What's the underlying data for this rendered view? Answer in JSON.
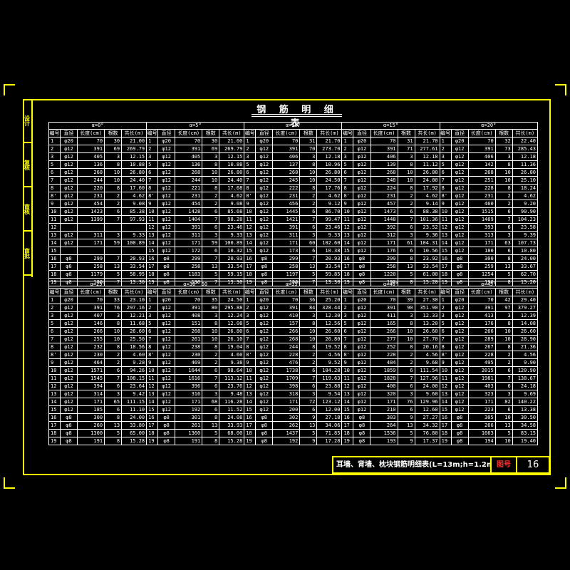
{
  "side_labels": [
    "设计",
    "复核",
    "审核",
    "审批"
  ],
  "title": "钢 筋 明 细 表",
  "header_cols": [
    "编号",
    "直径",
    "长度(cm)",
    "根数",
    "共长(m)"
  ],
  "top_angles": [
    "α=0°",
    "α=5°",
    "α=10°",
    "α=15°",
    "α=20°"
  ],
  "bottom_angles": [
    "α=25°",
    "α=30°  60",
    "α=35°",
    "α=40°",
    "α=45°"
  ],
  "top_rows": [
    [
      "1",
      "φ20",
      "70",
      "30",
      "21.00",
      "1",
      "φ20",
      "70",
      "30",
      "21.00",
      "1",
      "φ20",
      "70",
      "31",
      "21.70",
      "1",
      "φ20",
      "70",
      "31",
      "21.70",
      "1",
      "φ20",
      "70",
      "32",
      "22.40"
    ],
    [
      "2",
      "φ12",
      "391",
      "69",
      "269.79",
      "2",
      "φ12",
      "391",
      "69",
      "269.79",
      "2",
      "φ12",
      "391",
      "70",
      "273.70",
      "2",
      "φ12",
      "391",
      "71",
      "277.61",
      "2",
      "φ12",
      "391",
      "73",
      "285.43"
    ],
    [
      "3",
      "φ12",
      "405",
      "3",
      "12.15",
      "3",
      "φ12",
      "405",
      "3",
      "12.15",
      "3",
      "φ12",
      "406",
      "3",
      "12.18",
      "3",
      "φ12",
      "406",
      "3",
      "12.18",
      "3",
      "φ12",
      "406",
      "3",
      "12.18"
    ],
    [
      "5",
      "φ12",
      "136",
      "8",
      "10.88",
      "5",
      "φ12",
      "136",
      "8",
      "10.88",
      "5",
      "φ12",
      "137",
      "8",
      "10.96",
      "5",
      "φ12",
      "139",
      "8",
      "11.12",
      "5",
      "φ12",
      "142",
      "8",
      "11.36"
    ],
    [
      "6",
      "φ12",
      "268",
      "10",
      "26.80",
      "6",
      "φ12",
      "268",
      "10",
      "26.80",
      "6",
      "φ12",
      "268",
      "10",
      "26.80",
      "6",
      "φ12",
      "268",
      "10",
      "26.80",
      "6",
      "φ12",
      "268",
      "10",
      "26.80"
    ],
    [
      "7",
      "φ12",
      "244",
      "10",
      "24.40",
      "7",
      "φ12",
      "244",
      "10",
      "24.40",
      "7",
      "φ12",
      "245",
      "10",
      "24.50",
      "7",
      "φ12",
      "248",
      "10",
      "24.80",
      "7",
      "φ12",
      "251",
      "10",
      "25.10"
    ],
    [
      "8",
      "φ12",
      "220",
      "8",
      "17.60",
      "8",
      "φ12",
      "221",
      "8",
      "17.68",
      "8",
      "φ12",
      "222",
      "8",
      "17.76",
      "8",
      "φ12",
      "224",
      "8",
      "17.92",
      "8",
      "φ12",
      "228",
      "8",
      "18.24"
    ],
    [
      "8'",
      "φ12",
      "231",
      "2",
      "4.62",
      "8'",
      "φ12",
      "231",
      "2",
      "4.62",
      "8'",
      "φ12",
      "231",
      "2",
      "4.62",
      "8'",
      "φ12",
      "231",
      "2",
      "4.62",
      "8'",
      "φ12",
      "231",
      "2",
      "4.62"
    ],
    [
      "9",
      "φ12",
      "454",
      "2",
      "9.08",
      "9",
      "φ12",
      "454",
      "2",
      "9.08",
      "9",
      "φ12",
      "456",
      "2",
      "9.12",
      "9",
      "φ12",
      "457",
      "2",
      "9.14",
      "9",
      "φ12",
      "460",
      "2",
      "9.20"
    ],
    [
      "10",
      "φ12",
      "1423",
      "6",
      "85.38",
      "10",
      "φ12",
      "1428",
      "6",
      "85.68",
      "10",
      "φ12",
      "1445",
      "6",
      "86.70",
      "10",
      "φ12",
      "1473",
      "6",
      "88.38",
      "10",
      "φ12",
      "1515",
      "6",
      "90.90"
    ],
    [
      "11",
      "φ12",
      "1399",
      "7",
      "97.93",
      "11",
      "φ12",
      "1404",
      "7",
      "98.28",
      "11",
      "φ12",
      "1421",
      "7",
      "99.47",
      "11",
      "φ12",
      "1448",
      "7",
      "101.36",
      "11",
      "φ12",
      "1489",
      "7",
      "104.23"
    ],
    [
      "12",
      "",
      "",
      "",
      "",
      "12",
      "φ12",
      "391",
      "6",
      "23.46",
      "12",
      "φ12",
      "391",
      "6",
      "23.46",
      "12",
      "φ12",
      "392",
      "6",
      "23.52",
      "12",
      "φ12",
      "393",
      "6",
      "23.58"
    ],
    [
      "13",
      "φ12",
      "311",
      "3",
      "9.33",
      "13",
      "φ12",
      "311",
      "3",
      "9.33",
      "13",
      "φ12",
      "311",
      "3",
      "9.33",
      "13",
      "φ12",
      "312",
      "3",
      "9.36",
      "13",
      "φ12",
      "313",
      "3",
      "9.39"
    ],
    [
      "14",
      "φ12",
      "171",
      "59",
      "100.89",
      "14",
      "φ12",
      "171",
      "59",
      "100.89",
      "14",
      "φ12",
      "171",
      "60",
      "102.60",
      "14",
      "φ12",
      "171",
      "61",
      "104.31",
      "14",
      "φ12",
      "171",
      "63",
      "107.73"
    ],
    [
      "15",
      "",
      "",
      "",
      "",
      "15",
      "φ12",
      "172",
      "6",
      "10.32",
      "15",
      "φ12",
      "173",
      "6",
      "10.38",
      "15",
      "φ12",
      "176",
      "6",
      "10.56",
      "15",
      "φ12",
      "180",
      "6",
      "10.80"
    ],
    [
      "16",
      "φ8",
      "299",
      "7",
      "20.93",
      "16",
      "φ8",
      "299",
      "7",
      "20.93",
      "16",
      "φ8",
      "299",
      "7",
      "20.93",
      "16",
      "φ8",
      "299",
      "8",
      "23.92",
      "16",
      "φ8",
      "300",
      "8",
      "24.00"
    ],
    [
      "17",
      "φ8",
      "258",
      "13",
      "33.54",
      "17",
      "φ8",
      "258",
      "13",
      "33.54",
      "17",
      "φ8",
      "258",
      "13",
      "33.54",
      "17",
      "φ8",
      "258",
      "13",
      "33.54",
      "17",
      "φ8",
      "259",
      "13",
      "33.67"
    ],
    [
      "18",
      "φ8",
      "1179",
      "5",
      "58.95",
      "18",
      "φ8",
      "1183",
      "5",
      "59.15",
      "18",
      "φ8",
      "1197",
      "5",
      "59.85",
      "18",
      "φ8",
      "1220",
      "5",
      "61.00",
      "18",
      "φ8",
      "1254",
      "5",
      "62.70"
    ],
    [
      "19",
      "φ8",
      "190",
      "7",
      "13.30",
      "19",
      "φ8",
      "190",
      "7",
      "13.30",
      "19",
      "φ8",
      "190",
      "7",
      "13.30",
      "19",
      "φ8",
      "190",
      "8",
      "15.20",
      "19",
      "φ8",
      "190",
      "8",
      "15.20"
    ]
  ],
  "bottom_rows": [
    [
      "1",
      "φ20",
      "70",
      "33",
      "23.10",
      "1",
      "φ20",
      "70",
      "35",
      "24.50",
      "1",
      "φ20",
      "70",
      "36",
      "25.20",
      "1",
      "φ20",
      "70",
      "39",
      "27.30",
      "1",
      "φ20",
      "70",
      "42",
      "29.40"
    ],
    [
      "2",
      "φ12",
      "391",
      "76",
      "297.16",
      "2",
      "φ12",
      "391",
      "80",
      "295.88",
      "2",
      "φ12",
      "391",
      "84",
      "328.44",
      "2",
      "φ12",
      "391",
      "90",
      "351.90",
      "2",
      "φ12",
      "391",
      "97",
      "379.27"
    ],
    [
      "3",
      "φ12",
      "407",
      "3",
      "12.21",
      "3",
      "φ12",
      "408",
      "3",
      "12.24",
      "3",
      "φ12",
      "410",
      "3",
      "12.30",
      "3",
      "φ12",
      "411",
      "3",
      "12.33",
      "3",
      "φ12",
      "413",
      "3",
      "12.39"
    ],
    [
      "5",
      "φ12",
      "146",
      "8",
      "11.68",
      "5",
      "φ12",
      "151",
      "8",
      "12.08",
      "5",
      "φ12",
      "157",
      "8",
      "12.56",
      "5",
      "φ12",
      "165",
      "8",
      "13.20",
      "5",
      "φ12",
      "176",
      "8",
      "14.08"
    ],
    [
      "6",
      "φ12",
      "266",
      "10",
      "26.60",
      "6",
      "φ12",
      "268",
      "10",
      "26.80",
      "6",
      "φ12",
      "266",
      "10",
      "26.60",
      "6",
      "φ12",
      "266",
      "10",
      "26.60",
      "6",
      "φ12",
      "266",
      "10",
      "26.60"
    ],
    [
      "7",
      "φ12",
      "255",
      "10",
      "25.50",
      "7",
      "φ12",
      "261",
      "10",
      "26.10",
      "7",
      "φ12",
      "268",
      "10",
      "26.80",
      "7",
      "φ12",
      "277",
      "10",
      "27.70",
      "7",
      "φ12",
      "289",
      "10",
      "28.90"
    ],
    [
      "8",
      "φ12",
      "232",
      "8",
      "18.56",
      "8",
      "φ12",
      "238",
      "8",
      "19.04",
      "8",
      "φ12",
      "244",
      "8",
      "19.52",
      "8",
      "φ12",
      "252",
      "8",
      "20.16",
      "8",
      "φ12",
      "267",
      "8",
      "21.36"
    ],
    [
      "8'",
      "φ12",
      "230",
      "2",
      "4.60",
      "8'",
      "φ12",
      "230",
      "2",
      "4.60",
      "8'",
      "φ12",
      "228",
      "2",
      "4.56",
      "8'",
      "φ12",
      "228",
      "2",
      "4.56",
      "8'",
      "φ12",
      "228",
      "2",
      "4.56"
    ],
    [
      "9",
      "φ12",
      "464",
      "2",
      "9.28",
      "9",
      "φ12",
      "469",
      "2",
      "9.38",
      "9",
      "φ12",
      "476",
      "2",
      "9.52",
      "9",
      "φ12",
      "484",
      "2",
      "9.68",
      "9",
      "φ12",
      "495",
      "2",
      "9.90"
    ],
    [
      "10",
      "φ12",
      "1571",
      "6",
      "94.26",
      "10",
      "φ12",
      "1644",
      "6",
      "98.64",
      "10",
      "φ12",
      "1738",
      "6",
      "104.28",
      "10",
      "φ12",
      "1859",
      "6",
      "111.54",
      "10",
      "φ12",
      "2015",
      "6",
      "120.90"
    ],
    [
      "11",
      "φ12",
      "1545",
      "7",
      "108.15",
      "11",
      "φ12",
      "1616",
      "7",
      "113.12",
      "11",
      "φ12",
      "1709",
      "7",
      "119.63",
      "11",
      "φ12",
      "1828",
      "7",
      "127.96",
      "11",
      "φ12",
      "1981",
      "7",
      "138.67"
    ],
    [
      "12",
      "φ12",
      "394",
      "6",
      "23.64",
      "12",
      "φ12",
      "396",
      "6",
      "23.76",
      "12",
      "φ12",
      "398",
      "6",
      "23.88",
      "12",
      "φ12",
      "400",
      "6",
      "24.00",
      "12",
      "φ12",
      "403",
      "6",
      "24.18"
    ],
    [
      "13",
      "φ12",
      "314",
      "3",
      "9.42",
      "13",
      "φ12",
      "316",
      "3",
      "9.48",
      "13",
      "φ12",
      "318",
      "3",
      "9.54",
      "13",
      "φ12",
      "320",
      "3",
      "9.60",
      "13",
      "φ12",
      "323",
      "3",
      "9.69"
    ],
    [
      "14",
      "φ12",
      "171",
      "65",
      "111.15",
      "14",
      "φ12",
      "171",
      "68",
      "116.28",
      "14",
      "φ12",
      "171",
      "72",
      "123.12",
      "14",
      "φ12",
      "171",
      "76",
      "129.96",
      "14",
      "φ12",
      "171",
      "82",
      "140.22"
    ],
    [
      "15",
      "φ12",
      "185",
      "6",
      "11.10",
      "15",
      "φ12",
      "192",
      "6",
      "11.52",
      "15",
      "φ12",
      "200",
      "6",
      "12.00",
      "15",
      "φ12",
      "210",
      "6",
      "12.60",
      "15",
      "φ12",
      "223",
      "6",
      "13.38"
    ],
    [
      "16",
      "φ8",
      "300",
      "8",
      "24.00",
      "16",
      "φ8",
      "301",
      "8",
      "24.08",
      "16",
      "φ8",
      "302",
      "9",
      "27.18",
      "16",
      "φ8",
      "303",
      "9",
      "27.27",
      "16",
      "φ8",
      "305",
      "10",
      "30.50"
    ],
    [
      "17",
      "φ8",
      "260",
      "13",
      "33.80",
      "17",
      "φ8",
      "261",
      "13",
      "33.93",
      "17",
      "φ8",
      "262",
      "13",
      "34.06",
      "17",
      "φ8",
      "264",
      "13",
      "34.32",
      "17",
      "φ8",
      "266",
      "13",
      "34.58"
    ],
    [
      "18",
      "φ8",
      "1300",
      "5",
      "65.00",
      "18",
      "φ8",
      "1360",
      "5",
      "68.00",
      "18",
      "φ8",
      "1437",
      "5",
      "71.85",
      "18",
      "φ8",
      "1536",
      "5",
      "76.80",
      "18",
      "φ8",
      "1663",
      "5",
      "83.15"
    ],
    [
      "19",
      "φ8",
      "191",
      "8",
      "15.28",
      "19",
      "φ8",
      "191",
      "8",
      "15.28",
      "19",
      "φ8",
      "192",
      "9",
      "17.28",
      "19",
      "φ8",
      "193",
      "9",
      "17.37",
      "19",
      "φ8",
      "194",
      "10",
      "19.40"
    ]
  ],
  "titleblock": {
    "name": "耳墙、背墙、枕块钢筋明细表(L=13m;h=1.2m)",
    "label": "图号",
    "number": "16"
  }
}
